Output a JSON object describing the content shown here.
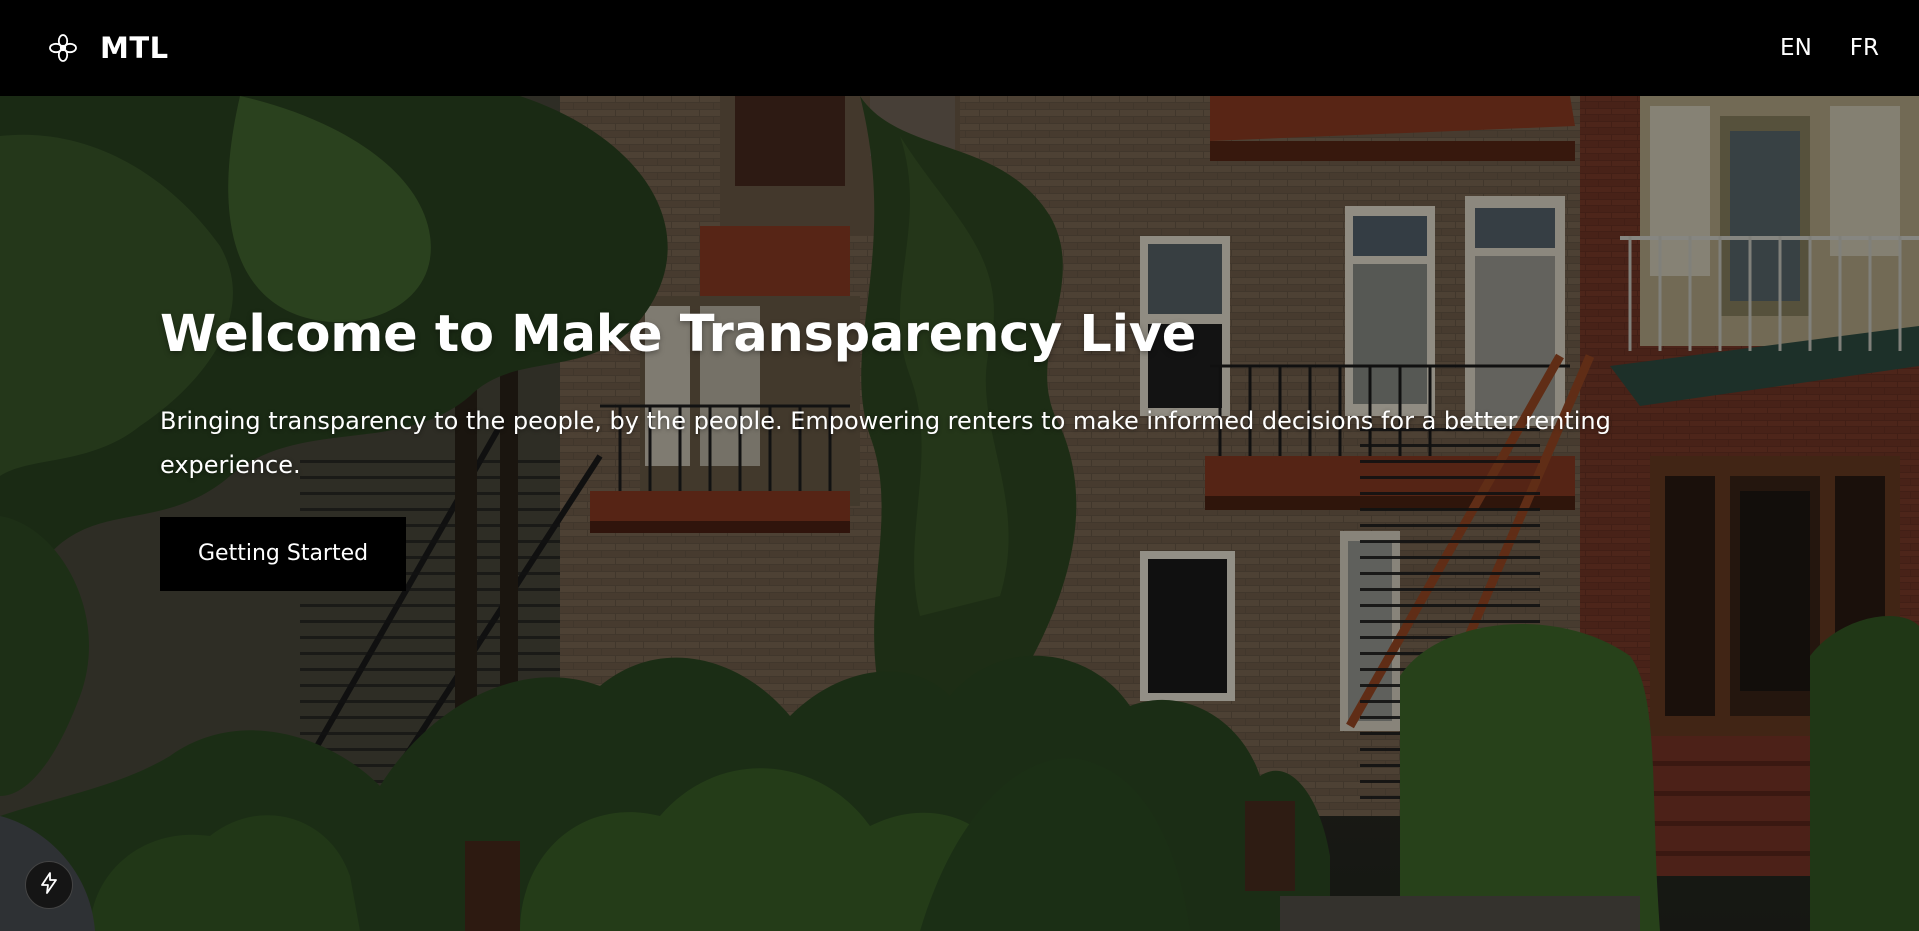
{
  "nav": {
    "brand": "MTL",
    "brand_icon": "flower-logo-icon",
    "languages": [
      "EN",
      "FR"
    ]
  },
  "hero": {
    "title": "Welcome to Make Transparency Live",
    "subtitle": "Bringing transparency to the people, by the people. Empowering renters to make informed decisions for a better renting experience.",
    "cta_label": "Getting Started",
    "background": "montreal-brick-triplexes-with-exterior-staircases-and-greenery"
  },
  "floating_button": {
    "icon": "lightning-bolt-icon"
  },
  "colors": {
    "nav_background": "#000000",
    "cta_background": "#000000",
    "text": "#ffffff"
  }
}
